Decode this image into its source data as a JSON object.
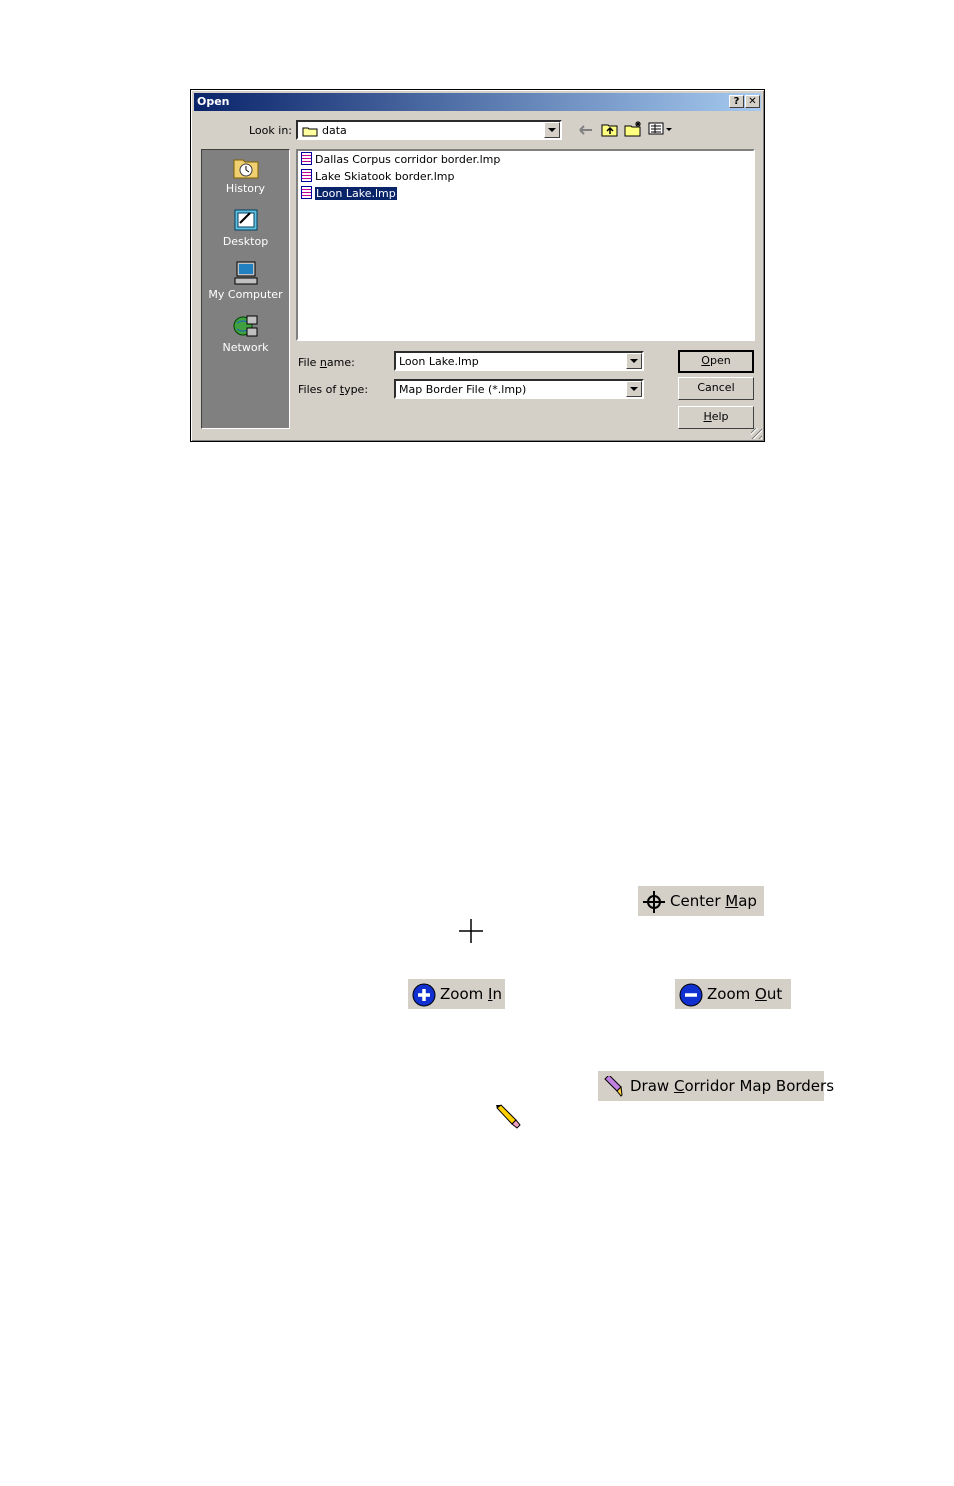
{
  "dialog": {
    "title": "Open",
    "help_btn": "?",
    "close_btn": "✕",
    "look_in_label": "Look in:",
    "look_in_value": "data",
    "places": [
      {
        "label": "History",
        "icon": "history-icon"
      },
      {
        "label": "Desktop",
        "icon": "desktop-icon"
      },
      {
        "label": "My Computer",
        "icon": "my-computer-icon"
      },
      {
        "label": "Network",
        "icon": "network-icon"
      }
    ],
    "files": [
      {
        "name": "Dallas Corpus corridor border.lmp",
        "selected": false
      },
      {
        "name": "Lake Skiatook border.lmp",
        "selected": false
      },
      {
        "name": "Loon Lake.lmp",
        "selected": true
      }
    ],
    "file_name_label": "File name:",
    "file_name_value": "Loon Lake.lmp",
    "files_of_type_label": "Files of type:",
    "files_of_type_value": "Map Border File (*.lmp)",
    "open_label": "Open",
    "cancel_label": "Cancel",
    "help_label": "Help"
  },
  "buttons": {
    "center_map": "Center Map",
    "zoom_in": "Zoom In",
    "zoom_out": "Zoom Out",
    "draw_borders": "Draw Corridor Map Borders"
  }
}
